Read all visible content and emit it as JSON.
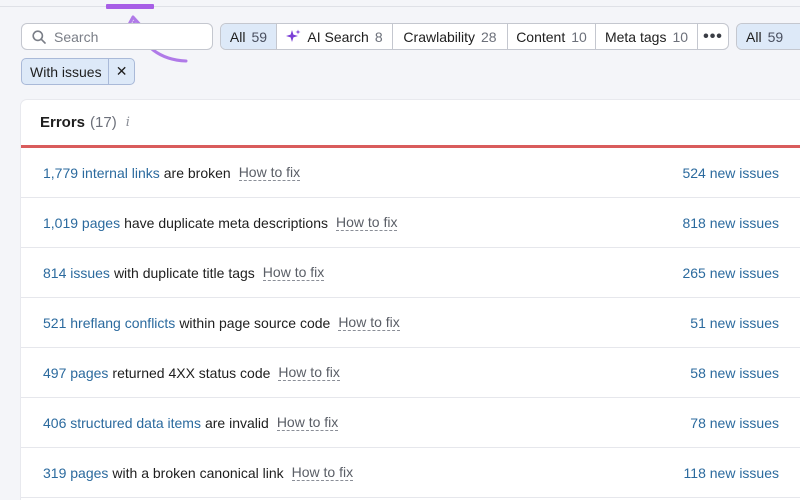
{
  "search": {
    "placeholder": "Search"
  },
  "filters": [
    {
      "label": "All",
      "count": "59",
      "active": true
    },
    {
      "label": "AI Search",
      "count": "8",
      "active": false,
      "icon": "sparkle-icon"
    },
    {
      "label": "Crawlability",
      "count": "28",
      "active": false
    },
    {
      "label": "Content",
      "count": "10",
      "active": false
    },
    {
      "label": "Meta tags",
      "count": "10",
      "active": false
    },
    {
      "label": "•••",
      "icon": "more-icon"
    }
  ],
  "right_filter": {
    "label": "All",
    "count": "59"
  },
  "chip": {
    "label": "With issues",
    "close": "✕"
  },
  "panel": {
    "title": "Errors",
    "count": "(17)",
    "info": "i"
  },
  "how_to_fix": "How to fix",
  "rows": [
    {
      "link": "1,779 internal links",
      "text": "are broken",
      "new": "524 new issues"
    },
    {
      "link": "1,019 pages",
      "text": "have duplicate meta descriptions",
      "new": "818 new issues"
    },
    {
      "link": "814 issues",
      "text": "with duplicate title tags",
      "new": "265 new issues"
    },
    {
      "link": "521 hreflang conflicts",
      "text": "within page source code",
      "new": "51 new issues"
    },
    {
      "link": "497 pages",
      "text": "returned 4XX status code",
      "new": "58 new issues"
    },
    {
      "link": "406 structured data items",
      "text": "are invalid",
      "new": "78 new issues"
    },
    {
      "link": "319 pages",
      "text": "with a broken canonical link",
      "new": "118 new issues"
    }
  ],
  "colors": {
    "accent": "#a75ee6",
    "link": "#2b6a9e",
    "error_bar": "#d95c5c",
    "active_filter": "#dde9f8"
  }
}
